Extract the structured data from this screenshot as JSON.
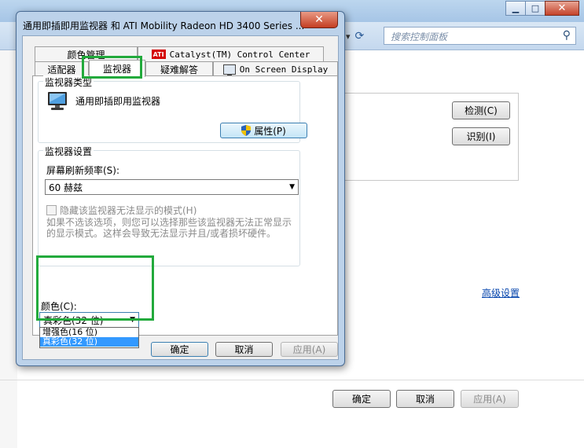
{
  "background_window": {
    "search_placeholder": "搜索控制面板",
    "detect_label": "检测(C)",
    "identify_label": "识别(I)",
    "advanced_link": "高级设置",
    "ok_label": "确定",
    "cancel_label": "取消",
    "apply_label": "应用(A)"
  },
  "dialog": {
    "title": "通用即插即用监视器 和 ATI Mobility Radeon HD 3400 Series ...",
    "close_glyph": "✕",
    "tabs": {
      "color_management": "颜色管理",
      "catalyst": "Catalyst(TM) Control Center",
      "ati_logo_text": "ATI",
      "adapter": "适配器",
      "monitor": "监视器",
      "troubleshoot": "疑难解答",
      "osd": "On Screen Display"
    },
    "monitor_type": {
      "group_title": "监视器类型",
      "monitor_name": "通用即插即用监视器",
      "properties_label": "属性(P)"
    },
    "monitor_settings": {
      "group_title": "监视器设置",
      "refresh_label": "屏幕刷新频率(S):",
      "refresh_value": "60 赫兹",
      "hide_modes_label": "隐藏该监视器无法显示的模式(H)",
      "hide_modes_desc": "如果不选该选项，则您可以选择那些该监视器无法正常显示的显示模式。这样会导致无法显示并且/或者损坏硬件。"
    },
    "colors": {
      "label": "颜色(C):",
      "selected_value": "真彩色(32 位)",
      "options": [
        "增强色(16 位)",
        "真彩色(32 位)"
      ]
    },
    "buttons": {
      "ok": "确定",
      "cancel": "取消",
      "apply": "应用(A)"
    }
  },
  "colors": {
    "highlight": "#22aa3c",
    "selection": "#3399ff",
    "close_button": "#c43d22"
  }
}
